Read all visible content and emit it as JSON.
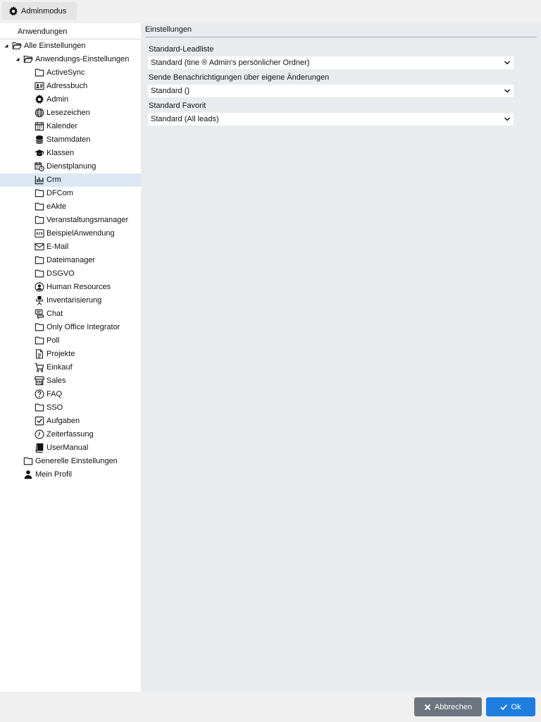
{
  "topbar": {
    "admin_label": "Adminmodus"
  },
  "tree": {
    "header": "Anwendungen",
    "root_label": "Alle Einstellungen",
    "app_settings_label": "Anwendungs-Einstellungen",
    "apps": [
      {
        "label": "ActiveSync",
        "icon": "folder-icon"
      },
      {
        "label": "Adressbuch",
        "icon": "address-card-icon"
      },
      {
        "label": "Admin",
        "icon": "gear-icon"
      },
      {
        "label": "Lesezeichen",
        "icon": "globe-icon"
      },
      {
        "label": "Kalender",
        "icon": "calendar-icon"
      },
      {
        "label": "Stammdaten",
        "icon": "database-icon"
      },
      {
        "label": "Klassen",
        "icon": "graduation-cap-icon"
      },
      {
        "label": "Dienstplanung",
        "icon": "calendar-clock-icon"
      },
      {
        "label": "Crm",
        "icon": "bar-chart-icon"
      },
      {
        "label": "DFCom",
        "icon": "folder-icon"
      },
      {
        "label": "eAkte",
        "icon": "folder-icon"
      },
      {
        "label": "Veranstaltungsmanager",
        "icon": "folder-icon"
      },
      {
        "label": "BeispielAnwendung",
        "icon": "code-window-icon"
      },
      {
        "label": "E-Mail",
        "icon": "envelope-icon"
      },
      {
        "label": "Dateimanager",
        "icon": "folder-icon"
      },
      {
        "label": "DSGVO",
        "icon": "folder-icon"
      },
      {
        "label": "Human Resources",
        "icon": "user-circle-icon"
      },
      {
        "label": "Inventarisierung",
        "icon": "office-chair-icon"
      },
      {
        "label": "Chat",
        "icon": "chat-icon"
      },
      {
        "label": "Only Office Integrator",
        "icon": "folder-icon"
      },
      {
        "label": "Poll",
        "icon": "folder-icon"
      },
      {
        "label": "Projekte",
        "icon": "document-icon"
      },
      {
        "label": "Einkauf",
        "icon": "cart-icon"
      },
      {
        "label": "Sales",
        "icon": "store-icon"
      },
      {
        "label": "FAQ",
        "icon": "question-circle-icon"
      },
      {
        "label": "SSO",
        "icon": "folder-icon"
      },
      {
        "label": "Aufgaben",
        "icon": "checkbox-icon"
      },
      {
        "label": "Zeiterfassung",
        "icon": "clock-icon"
      },
      {
        "label": "UserManual",
        "icon": "book-icon"
      }
    ],
    "general_label": "Generelle Einstellungen",
    "profile_label": "Mein Profil"
  },
  "settings": {
    "header": "Einstellungen",
    "fields": [
      {
        "label": "Standard-Leadliste",
        "value": "Standard (tine ® Admin's persönlicher Ordner)"
      },
      {
        "label": "Sende Benachrichtigungen über eigene Änderungen",
        "value": "Standard ()"
      },
      {
        "label": "Standard Favorit",
        "value": "Standard (All leads)"
      }
    ]
  },
  "footer": {
    "cancel_label": "Abbrechen",
    "ok_label": "Ok"
  },
  "colors": {
    "accent": "#1e7ee0",
    "cancel": "#6c757d",
    "selected_row": "#dbe8f4",
    "panel_bg": "#e9ecef"
  }
}
